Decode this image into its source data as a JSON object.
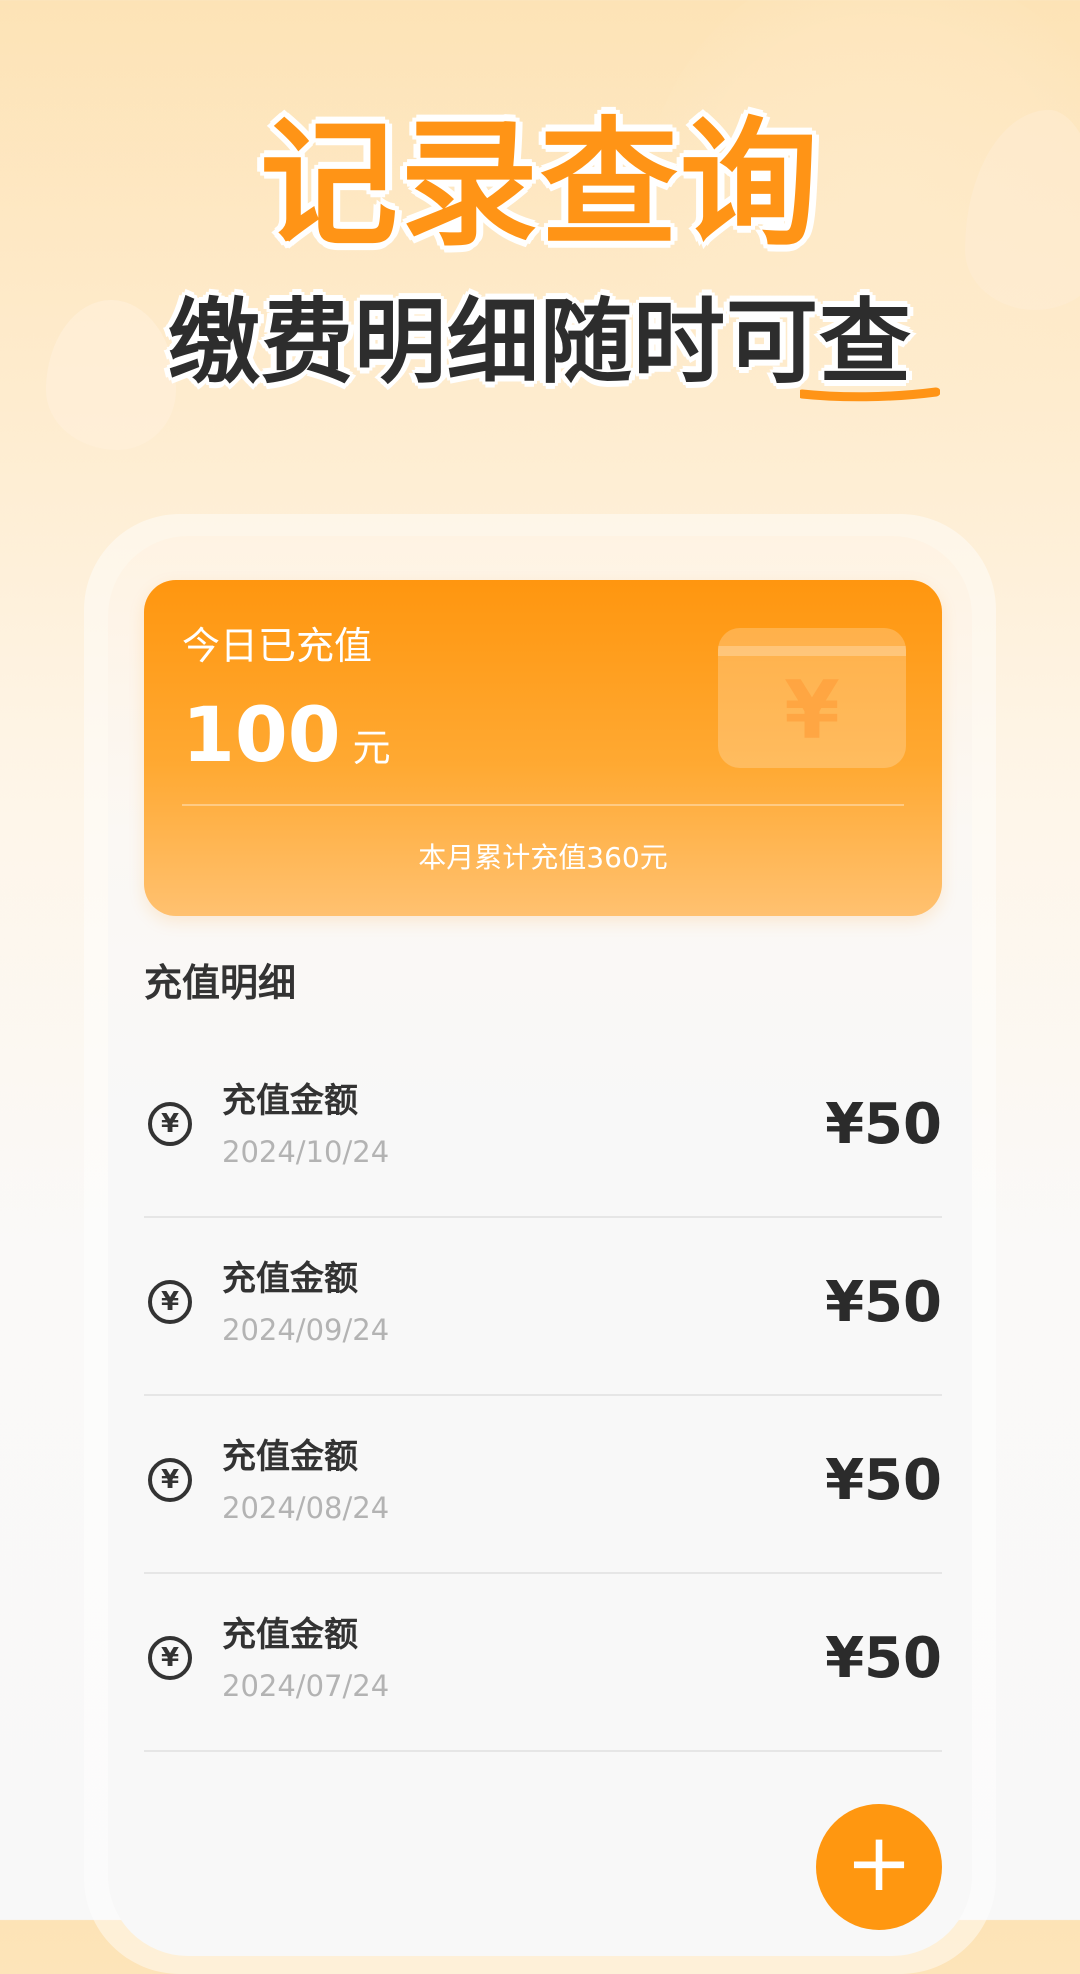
{
  "hero": {
    "title": "记录查询",
    "subtitle": "缴费明细随时可查"
  },
  "summary": {
    "label": "今日已充值",
    "amount": "100",
    "unit": "元",
    "wallet_symbol": "¥",
    "monthly_total": "本月累计充值360元"
  },
  "details": {
    "section_title": "充值明细",
    "records": [
      {
        "icon": "¥",
        "title": "充值金额",
        "date": "2024/10/24",
        "amount": "¥50"
      },
      {
        "icon": "¥",
        "title": "充值金额",
        "date": "2024/09/24",
        "amount": "¥50"
      },
      {
        "icon": "¥",
        "title": "充值金额",
        "date": "2024/08/24",
        "amount": "¥50"
      },
      {
        "icon": "¥",
        "title": "充值金额",
        "date": "2024/07/24",
        "amount": "¥50"
      }
    ]
  },
  "fab": {
    "icon": "plus-icon",
    "symbol": "+"
  },
  "colors": {
    "accent": "#FF9416",
    "card_gradient_top": "#FF960F",
    "card_gradient_bottom": "#FFC170",
    "text_primary": "#333333",
    "text_secondary": "#B3B3B3"
  }
}
